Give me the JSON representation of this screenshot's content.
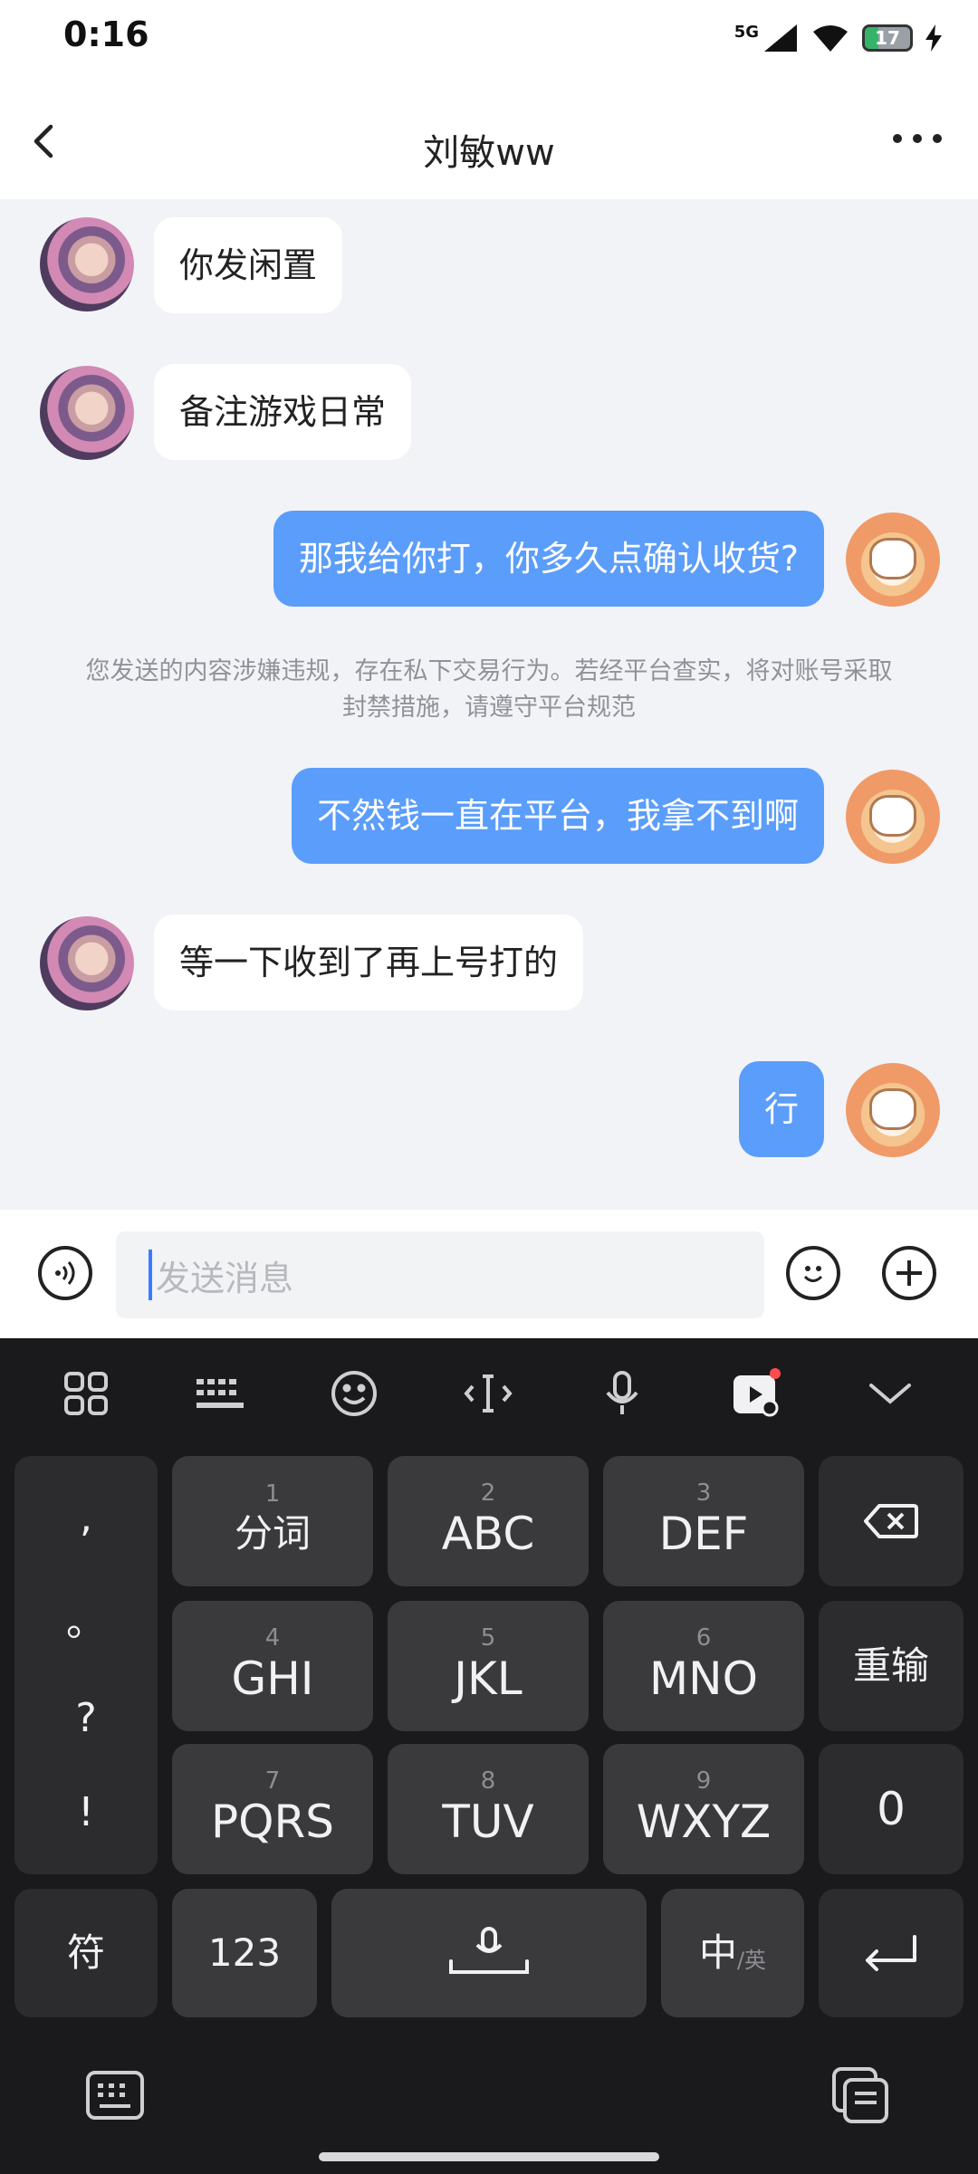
{
  "status_bar": {
    "time": "0:16",
    "network": "5G",
    "battery": "17"
  },
  "header": {
    "title": "刘敏ww"
  },
  "messages": [
    {
      "side": "in",
      "text": "你发闲置"
    },
    {
      "side": "in",
      "text": "备注游戏日常"
    },
    {
      "side": "out",
      "text": "那我给你打，你多久点确认收货?"
    },
    {
      "side": "out",
      "text": "不然钱一直在平台，我拿不到啊"
    },
    {
      "side": "in",
      "text": "等一下收到了再上号打的"
    },
    {
      "side": "out",
      "text": "行"
    }
  ],
  "notice": {
    "line1": "您发送的内容涉嫌违规，存在私下交易行为。若经平台查实，将对账号采取",
    "line2": "封禁措施，请遵守平台规范"
  },
  "input": {
    "placeholder": "发送消息"
  },
  "keyboard": {
    "punct": [
      ",",
      "。",
      "?",
      "!"
    ],
    "keys": [
      {
        "num": "1",
        "label": "分词"
      },
      {
        "num": "2",
        "label": "ABC"
      },
      {
        "num": "3",
        "label": "DEF"
      },
      {
        "num": "4",
        "label": "GHI"
      },
      {
        "num": "5",
        "label": "JKL"
      },
      {
        "num": "6",
        "label": "MNO"
      },
      {
        "num": "7",
        "label": "PQRS"
      },
      {
        "num": "8",
        "label": "TUV"
      },
      {
        "num": "9",
        "label": "WXYZ"
      }
    ],
    "side": {
      "reinput": "重输",
      "zero": "0"
    },
    "bottom": {
      "symbols": "符",
      "numbers": "123",
      "lang_main": "中",
      "lang_alt": "/英"
    }
  },
  "colors": {
    "outgoing_bubble": "#5b9dfb",
    "incoming_bubble": "#ffffff",
    "chat_bg": "#f2f3f7",
    "keyboard_bg": "#1a1a1c"
  }
}
